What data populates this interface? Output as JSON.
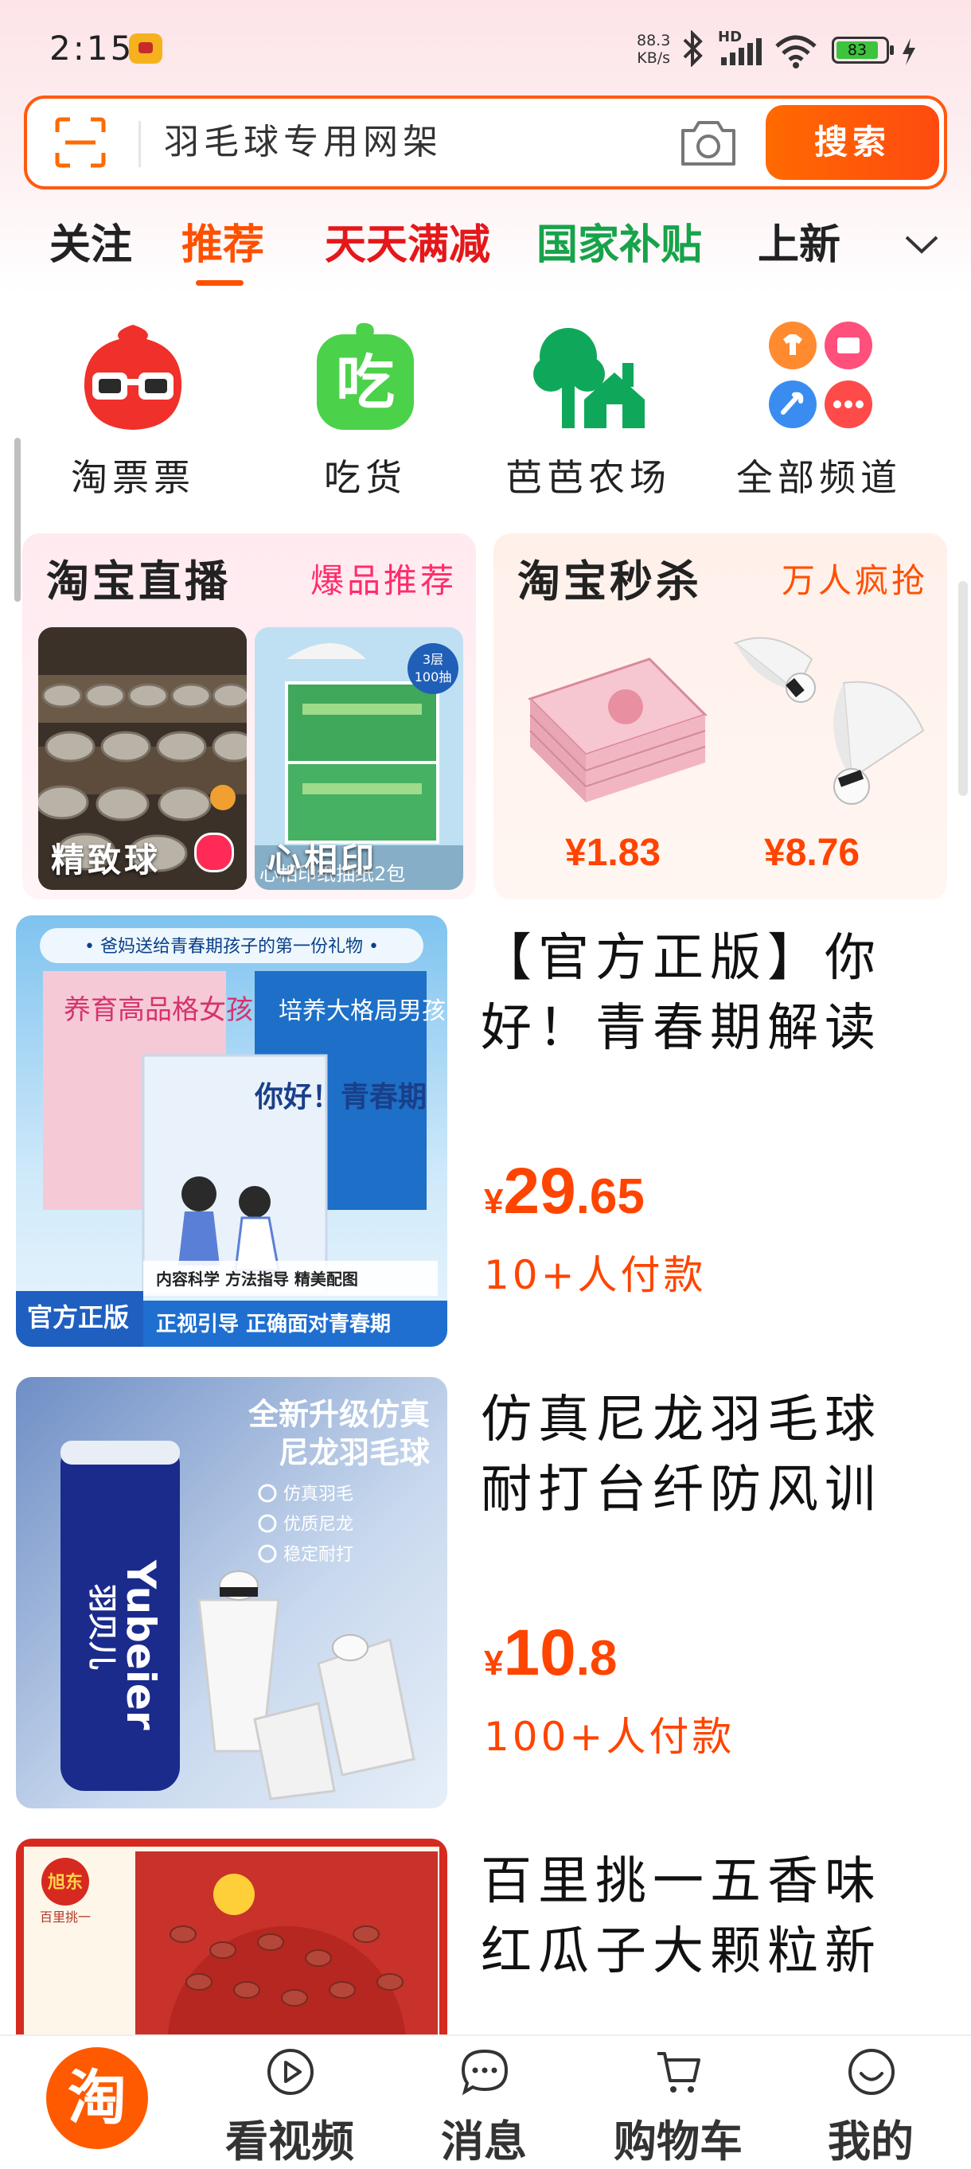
{
  "status_bar": {
    "time": "2:15",
    "net_speed_value": "88.3",
    "net_speed_unit": "KB/s",
    "network_type": "HD",
    "battery_level": "83"
  },
  "search": {
    "query": "羽毛球专用网架",
    "button_label": "搜索"
  },
  "tabs": [
    {
      "label": "关注",
      "color": "#222222"
    },
    {
      "label": "推荐",
      "color": "#ff5000"
    },
    {
      "label": "天天满减",
      "color": "#e4171a"
    },
    {
      "label": "国家补贴",
      "color": "#17a34a"
    },
    {
      "label": "上新",
      "color": "#222222"
    }
  ],
  "channels": [
    {
      "label": "淘票票",
      "icon": "taopiaopiao-icon"
    },
    {
      "label": "吃货",
      "icon": "chihuo-icon",
      "icon_text": "吃"
    },
    {
      "label": "芭芭农场",
      "icon": "baba-farm-icon"
    },
    {
      "label": "全部频道",
      "icon": "all-channels-icon"
    }
  ],
  "live_card": {
    "title": "淘宝直播",
    "subtitle": "爆品推荐",
    "subtitle_color": "#ff2d6b",
    "items": [
      {
        "caption": "精致球"
      },
      {
        "caption": "心相印",
        "badge_top": "3层",
        "badge_bottom": "100抽",
        "overlay_text": "心相印纸抽纸2包"
      }
    ]
  },
  "flash_card": {
    "title": "淘宝秒杀",
    "subtitle": "万人疯抢",
    "subtitle_color": "#ff5000",
    "items": [
      {
        "price": "¥1.83"
      },
      {
        "price": "¥8.76"
      }
    ]
  },
  "products": [
    {
      "title": "【官方正版】你好！青春期解读",
      "price_symbol": "¥",
      "price_main": "29",
      "price_decimal": ".65",
      "sold": "10+人付款",
      "image": {
        "banner": "• 爸妈送给青春期孩子的第一份礼物 •",
        "book1": "养育高品格女孩",
        "book2": "培养大格局男孩",
        "book3": "你好！青春期",
        "badge": "官方正版",
        "tags": "内容科学  方法指导  精美配图",
        "footer": "正视引导  正确面对青春期"
      }
    },
    {
      "title": "仿真尼龙羽毛球耐打台纤防风训",
      "price_symbol": "¥",
      "price_main": "10",
      "price_decimal": ".8",
      "sold": "100+人付款",
      "image": {
        "headline1": "全新升级仿真",
        "headline2": "尼龙羽毛球",
        "features": [
          "仿真羽毛",
          "优质尼龙",
          "稳定耐打"
        ],
        "brand": "Yubeier",
        "brand_cn": "羽贝儿"
      }
    },
    {
      "title": "百里挑一五香味红瓜子大颗粒新",
      "image": {
        "brand": "旭东",
        "slogan": "百里挑一"
      }
    }
  ],
  "bottom_nav": [
    {
      "label": "淘",
      "icon": "taobao-home-icon"
    },
    {
      "label": "看视频",
      "icon": "play-icon"
    },
    {
      "label": "消息",
      "icon": "message-icon"
    },
    {
      "label": "购物车",
      "icon": "cart-icon"
    },
    {
      "label": "我的",
      "icon": "profile-icon"
    }
  ]
}
